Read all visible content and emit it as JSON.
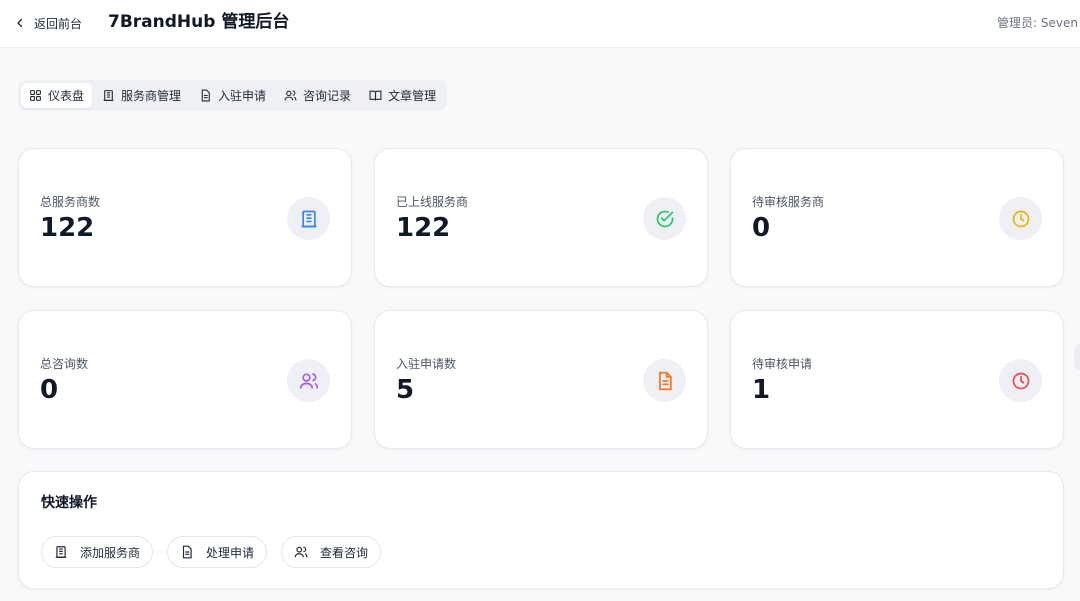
{
  "header": {
    "back_label": "返回前台",
    "title": "7BrandHub 管理后台",
    "admin_label": "管理员: Seven"
  },
  "tabs": [
    {
      "label": "仪表盘",
      "icon": "grid-icon",
      "active": true
    },
    {
      "label": "服务商管理",
      "icon": "building-icon",
      "active": false
    },
    {
      "label": "入驻申请",
      "icon": "document-icon",
      "active": false
    },
    {
      "label": "咨询记录",
      "icon": "users-icon",
      "active": false
    },
    {
      "label": "文章管理",
      "icon": "book-open-icon",
      "active": false
    }
  ],
  "stats": [
    {
      "label": "总服务商数",
      "value": "122",
      "icon": "building-icon",
      "color": "#3b82f6"
    },
    {
      "label": "已上线服务商",
      "value": "122",
      "icon": "check-circle-icon",
      "color": "#22c55e"
    },
    {
      "label": "待审核服务商",
      "value": "0",
      "icon": "clock-icon",
      "color": "#eab308"
    },
    {
      "label": "总咨询数",
      "value": "0",
      "icon": "users-icon",
      "color": "#a855f7"
    },
    {
      "label": "入驻申请数",
      "value": "5",
      "icon": "document-icon",
      "color": "#f97316"
    },
    {
      "label": "待审核申请",
      "value": "1",
      "icon": "clock-icon",
      "color": "#ef4444"
    }
  ],
  "quick": {
    "title": "快速操作",
    "actions": [
      {
        "label": "添加服务商",
        "icon": "building-icon"
      },
      {
        "label": "处理申请",
        "icon": "document-icon"
      },
      {
        "label": "查看咨询",
        "icon": "users-icon"
      }
    ]
  }
}
